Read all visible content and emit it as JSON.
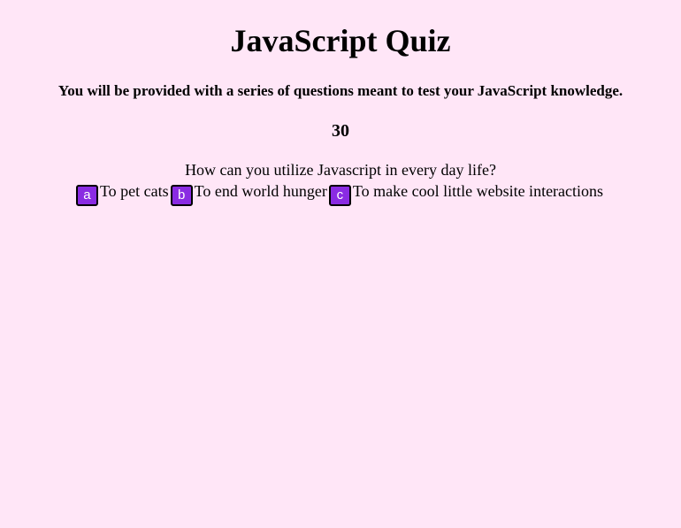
{
  "header": {
    "title": "JavaScript Quiz",
    "subtitle": "You will be provided with a series of questions meant to test your JavaScript knowledge."
  },
  "timer": {
    "value": "30"
  },
  "quiz": {
    "question": "How can you utilize Javascript in every day life?",
    "answers": [
      {
        "button": "a",
        "text": "To pet cats"
      },
      {
        "button": "b",
        "text": "To end world hunger"
      },
      {
        "button": "c",
        "text": "To make cool little website interactions"
      }
    ]
  },
  "colors": {
    "background": "#ffe6f7",
    "answer_button": "#8a2be2"
  }
}
